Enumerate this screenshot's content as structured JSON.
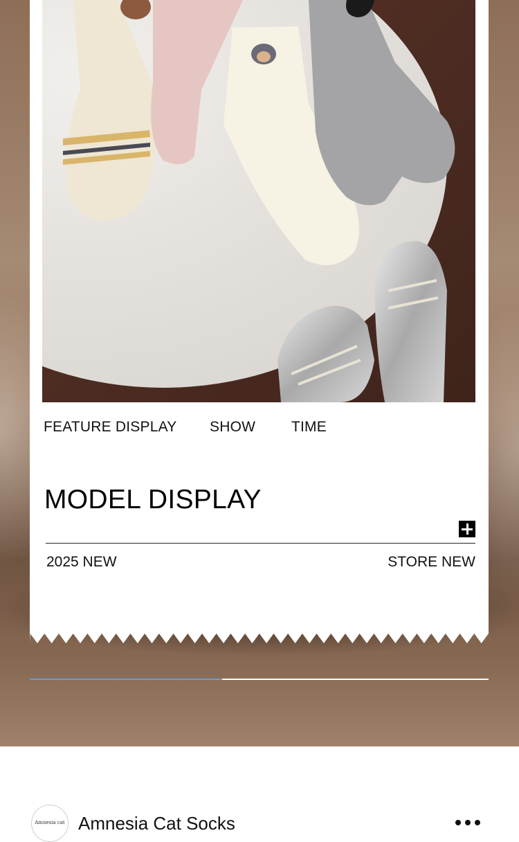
{
  "feature_tabs": [
    "FEATURE DISPLAY",
    "SHOW",
    "TIME"
  ],
  "section_title": "MODEL DISPLAY",
  "subtitle_left": "2025 NEW",
  "subtitle_right": "STORE NEW",
  "expand_icon": "plus-icon",
  "carousel": {
    "progress": 0.42,
    "accent_color": "#5aa2e0"
  },
  "store": {
    "avatar_text": "Amnesia cat",
    "name": "Amnesia Cat Socks",
    "menu_icon": "more-dots-icon"
  },
  "colors": {
    "background": "#9a7a62",
    "card": "#ffffff",
    "text": "#111111"
  }
}
